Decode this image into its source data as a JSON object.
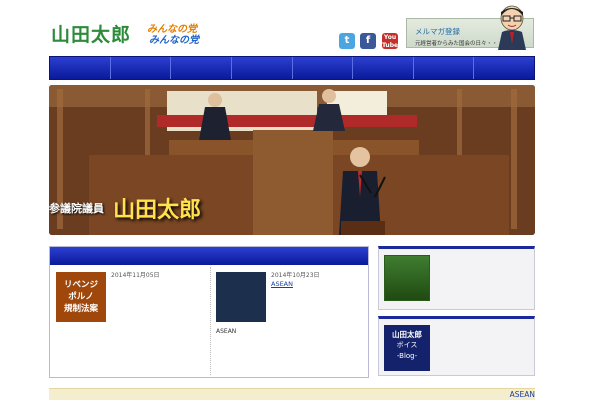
{
  "header": {
    "tagline": "",
    "logo_name": "山田太郎",
    "party_line1": "みんなの党",
    "party_line2": "みんなの党",
    "mailmag": {
      "label": "メルマガ登録",
      "sub": "元経営者からみた国会の日々・・・"
    },
    "social": {
      "twitter": "t",
      "facebook": "f",
      "youtube_line1": "You",
      "youtube_line2": "Tube"
    }
  },
  "nav": {
    "items": [
      "",
      "",
      "",
      "",
      "",
      "",
      "",
      ""
    ]
  },
  "hero": {
    "subtitle": "参議院議員",
    "name": "山田太郎"
  },
  "news": {
    "header": "",
    "cards": [
      {
        "date": "2014年11月05日",
        "title": "",
        "thumb_text_1": "リベンジ",
        "thumb_text_2": "ポルノ",
        "thumb_text_3": "規制法案",
        "body": "",
        "more": ""
      },
      {
        "date": "2014年10月23日",
        "title": "ASEAN",
        "body": "ASEAN",
        "more": ""
      }
    ]
  },
  "side": {
    "box1": {
      "title": "",
      "text": ""
    },
    "box2": {
      "title": "",
      "text": "",
      "img_line1": "山田太郎",
      "img_line2": "ボイス",
      "img_line3": "-Blog-"
    }
  },
  "bottom": {
    "link": "ASEAN"
  },
  "colors": {
    "nav_blue": "#0a1a9a",
    "logo_green": "#2e8b3a",
    "hero_yellow": "#ffe24d"
  }
}
